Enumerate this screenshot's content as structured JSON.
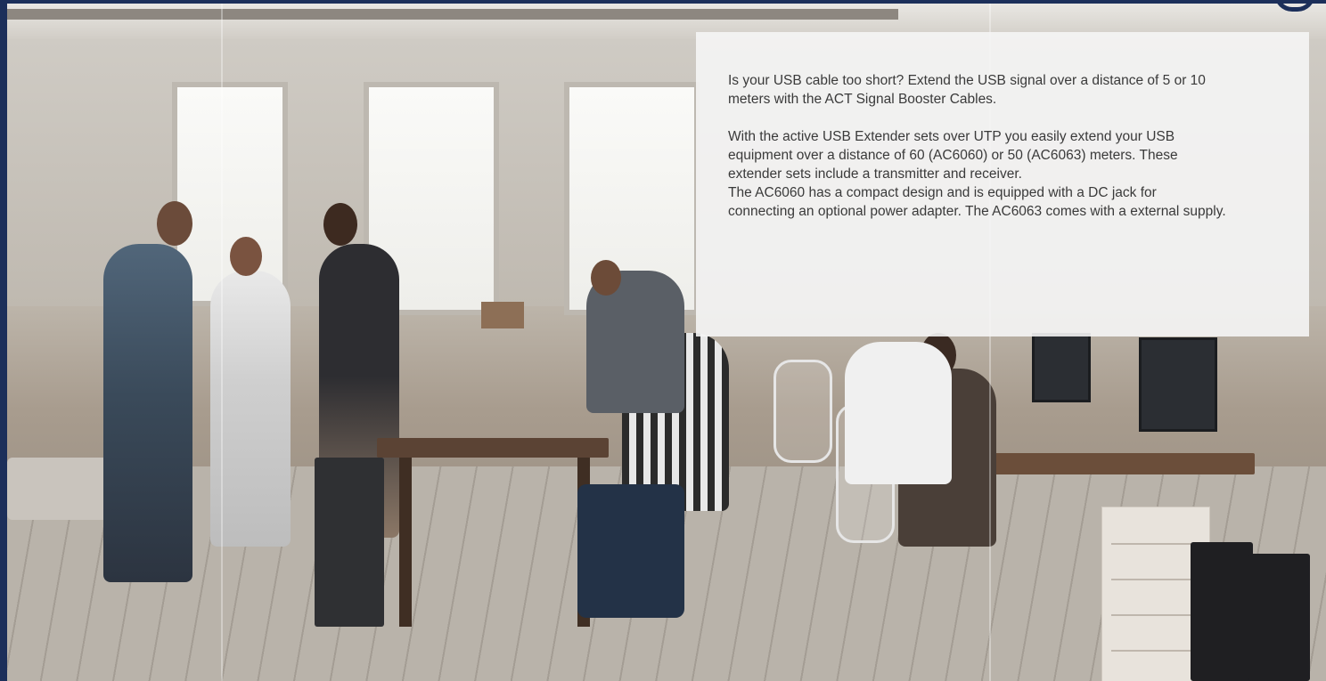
{
  "hero": {
    "image_alt_icon": "office-photo"
  },
  "intro": {
    "paragraph1": "Is your USB cable too short? Extend the USB signal over a distance of 5 or 10 meters with the ACT Signal Booster Cables.",
    "paragraph2": "With the active USB Extender sets over UTP you easily extend your USB equipment over a distance of 60 (AC6060) or 50 (AC6063) meters. These extender sets include a transmitter and receiver.",
    "paragraph3": "The AC6060 has a compact design and is equipped with a DC jack for connecting an optional power adapter. The AC6063 comes with a external supply."
  },
  "colors": {
    "frame": "#1c2f5a",
    "panel_bg": "#f5f5f5",
    "text": "#3a3a3a"
  }
}
